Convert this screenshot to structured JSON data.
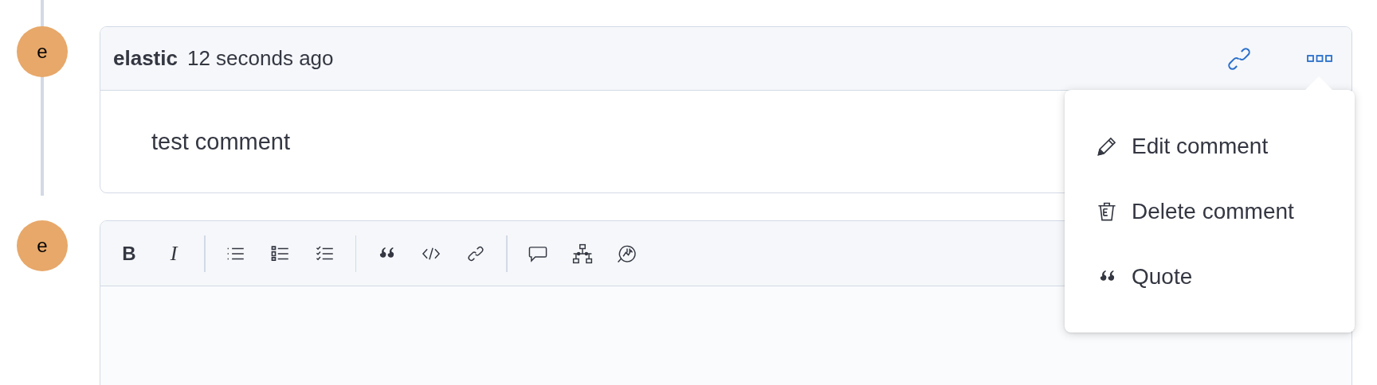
{
  "comment": {
    "avatar": "e",
    "author": "elastic",
    "time": "12 seconds ago",
    "body": "test comment",
    "menu_open": true
  },
  "menu": [
    {
      "kind": "edit",
      "label": "Edit comment"
    },
    {
      "kind": "delete",
      "label": "Delete comment"
    },
    {
      "kind": "quote",
      "label": "Quote"
    }
  ],
  "editor": {
    "avatar": "e",
    "toolbar": [
      [
        {
          "kind": "bold",
          "label": "B"
        },
        {
          "kind": "italic",
          "label": "I"
        }
      ],
      [
        {
          "kind": "bullet-list"
        },
        {
          "kind": "numbered-list"
        },
        {
          "kind": "task-list"
        }
      ],
      [
        {
          "kind": "quote"
        },
        {
          "kind": "code"
        },
        {
          "kind": "link"
        }
      ],
      [
        {
          "kind": "comment"
        },
        {
          "kind": "diagram"
        },
        {
          "kind": "chart"
        }
      ]
    ]
  }
}
